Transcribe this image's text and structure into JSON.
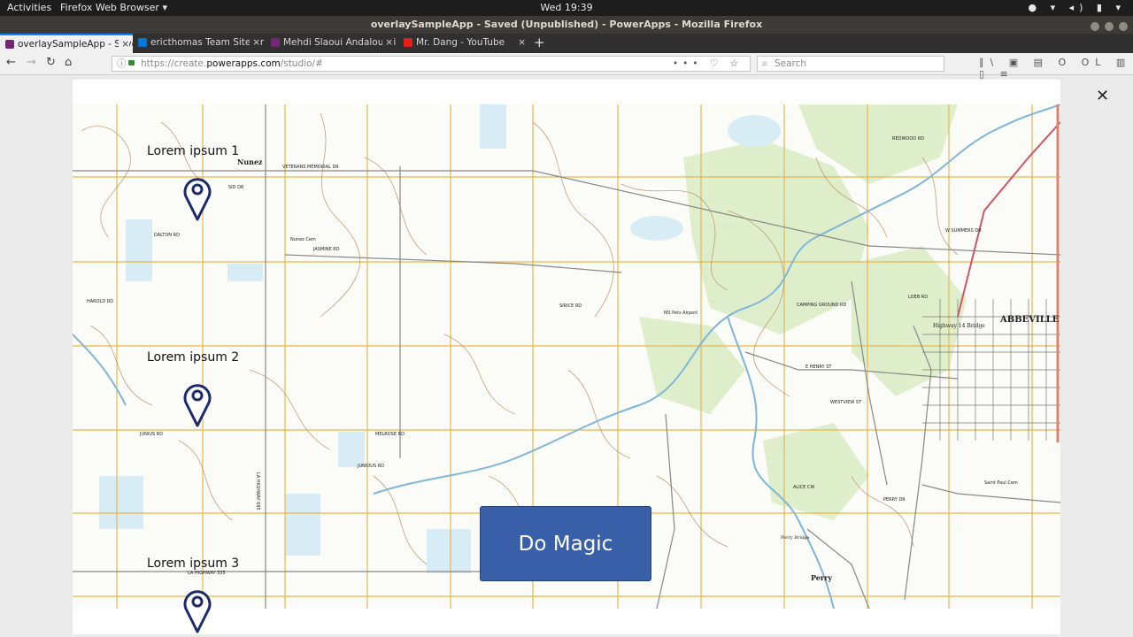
{
  "topbar": {
    "activities": "Activities",
    "app_menu": "Firefox Web Browser ▾",
    "clock": "Wed 19:39",
    "tray": "● ▾ ◂) ▮ ▾"
  },
  "window": {
    "title": "overlaySampleApp - Saved (Unpublished) - PowerApps - Mozilla Firefox"
  },
  "tabs": [
    {
      "label": "overlaySampleApp - Save",
      "close": "×",
      "color": "#742774"
    },
    {
      "label": "ericthomas Team Site - n",
      "close": "×",
      "color": "#0078d4"
    },
    {
      "label": "Mehdi Slaoui Andaloussi",
      "close": "×",
      "color": "#742774"
    },
    {
      "label": "Mr. Dang - YouTube",
      "close": "×",
      "color": "#e62117"
    }
  ],
  "newtab": "+",
  "nav": {
    "back": "←",
    "forward": "→",
    "reload": "↻",
    "home": "⌂",
    "url_prefix": "https://create.",
    "url_domain": "powerapps.com",
    "url_path": "/studio/#",
    "url_actions": "••• ♡ ☆",
    "search_placeholder": "Search",
    "toolbar_icons": "∥\\ ▣ ▤ O OL ▥ ▯ ≡"
  },
  "app": {
    "close": "✕",
    "button_label": "Do Magic",
    "labels": [
      "Lorem ipsum 1",
      "Lorem ipsum 2",
      "Lorem ipsum 3"
    ],
    "accent": "#3a5fa9",
    "pin_color": "#1b2a6b"
  },
  "map": {
    "places": [
      "Nunez",
      "ABBEVILLE",
      "Perry",
      "Highway 14 Bridge",
      "Perry Bridge",
      "VETERANS MEMORIAL DR",
      "DALTON RD",
      "HAROLD RD",
      "JUNIUS RD",
      "MELROSE RD",
      "JASMINE RD",
      "CAMPING GROUND RD",
      "W SUMMERS DR",
      "LA HIGHWAY 695",
      "LA HIGHWAY 335",
      "SIRICE RD",
      "ALICE CIR",
      "PERRY DR",
      "Saint Paul Cem",
      "MS Pets Airport",
      "Nunez Cem",
      "REDWOOD RD",
      "E HENRY ST",
      "WESTVIEW ST",
      "SID DR",
      "LOEB RD",
      "JUNIOUS RD"
    ]
  }
}
